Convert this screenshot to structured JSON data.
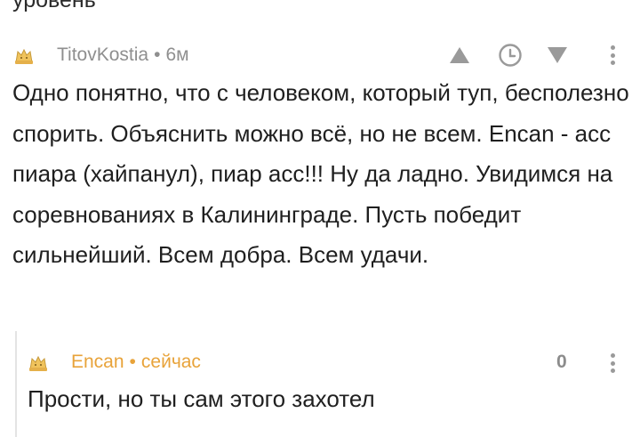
{
  "above": {
    "cut_text": "уровень"
  },
  "comment": {
    "author": "TitovKostia",
    "separator": "•",
    "time": "6м",
    "avatar_icon": "cat-avatar-icon",
    "text": "Одно понятно, что с человеком, который туп, бесполезно спорить. Объяснить можно всё, но не всем. Encan - асс пиара (хайпанул), пиар асс!!! Ну да ладно. Увидимся на соревнованиях в Калининграде. Пусть победит сильнейший. Всем добра. Всем удачи.",
    "actions": [
      "upvote-icon",
      "clock-icon",
      "downvote-icon",
      "more-icon"
    ]
  },
  "reply": {
    "author": "Encan",
    "separator": "•",
    "time": "сейчас",
    "avatar_icon": "cat-avatar-icon",
    "rating": "0",
    "text": "Прости, но ты сам этого захотел",
    "author_color": "#e8a33a"
  }
}
